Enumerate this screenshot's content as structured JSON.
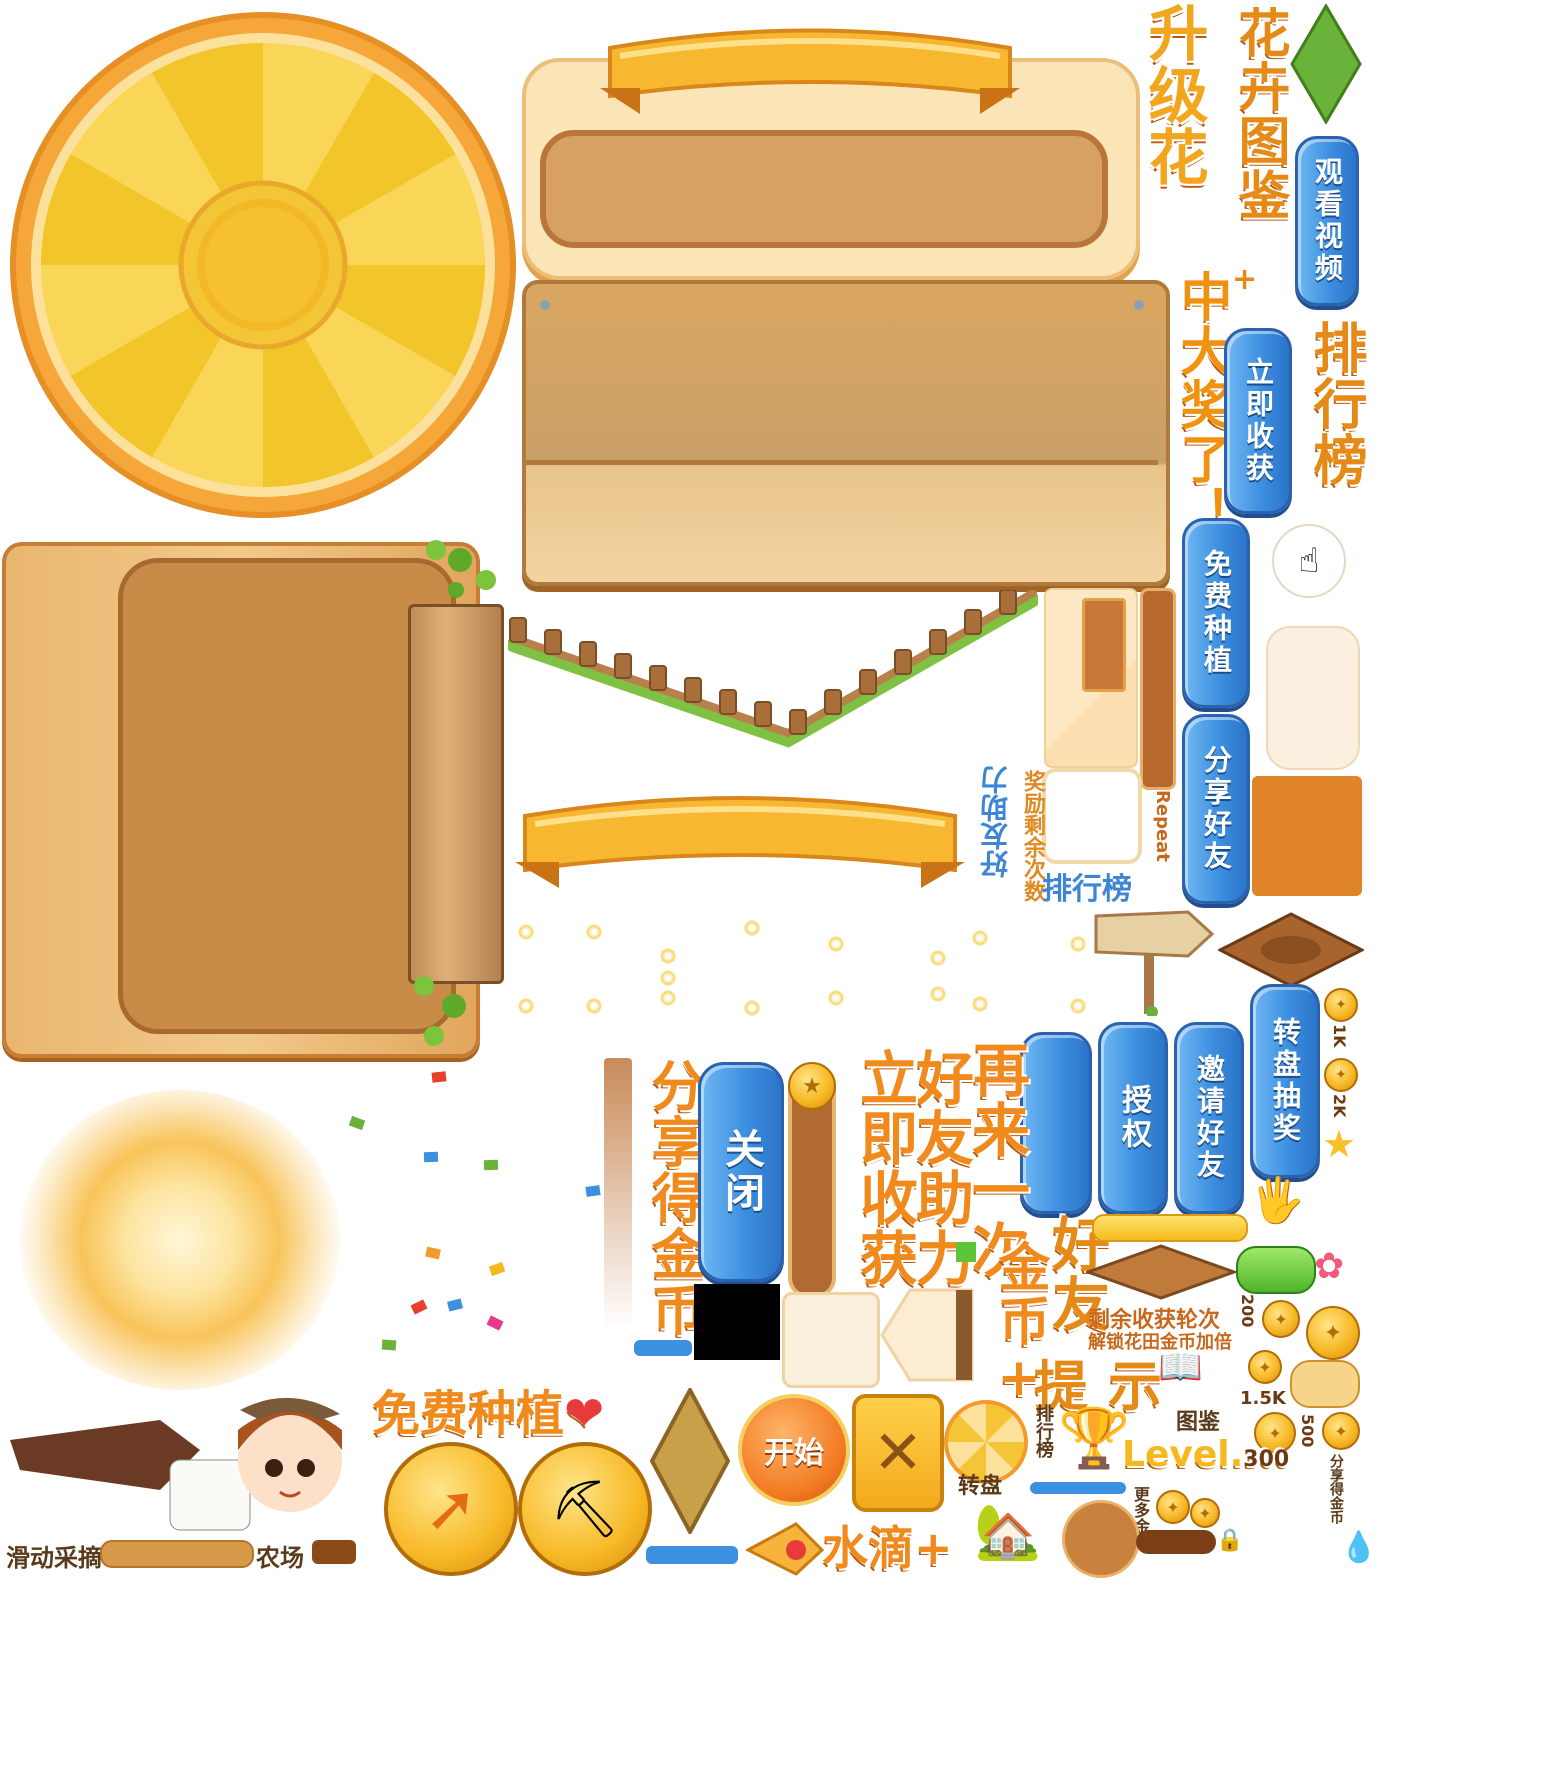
{
  "titles": {
    "upgrade_flower": "升级花",
    "flower_guide": "花卉图鉴",
    "jackpot": "中大奖了！",
    "ranking": "排行榜",
    "reward_remaining": "奖励剩余次数",
    "friend_help_small": "好友助力",
    "ranking_small": "排行榜",
    "repeat": "Repeat",
    "once_more": "再来一次",
    "friend_help": "好友助力",
    "harvest_now": "立即收获",
    "share_coins": "分享得金币",
    "gold_coin_plus": "金币+",
    "friend": "好友",
    "hint": "提示",
    "remaining_rounds": "剩余收获轮次",
    "unlock_double": "解锁花田金币加倍",
    "free_plant": "免费种植",
    "water_plus": "水滴+",
    "level": "Level.",
    "level_num": "300",
    "slide_pick": "滑动采摘",
    "farm": "农场"
  },
  "buttons": {
    "watch_video": "观看视频",
    "harvest_now": "立即收获",
    "free_plant": "免费种植",
    "share_friend": "分享好友",
    "authorize": "授权",
    "invite_friend": "邀请好友",
    "wheel_lottery": "转盘抽奖",
    "close": "关闭",
    "start": "开始"
  },
  "icons": {
    "guide": "图鉴",
    "wheel": "转盘",
    "rank_small": "排行榜",
    "more_coins": "更多金币",
    "share_get": "分享得金币"
  },
  "coins": {
    "c1": "1K",
    "c2": "2K",
    "c3": "200",
    "c4": "1.5K",
    "c5": "500"
  },
  "colors": {
    "blue_button": "#3d8fe0",
    "orange_text": "#f08a1c",
    "wood": "#d9a25e",
    "panel_brown": "#c88a4a"
  }
}
